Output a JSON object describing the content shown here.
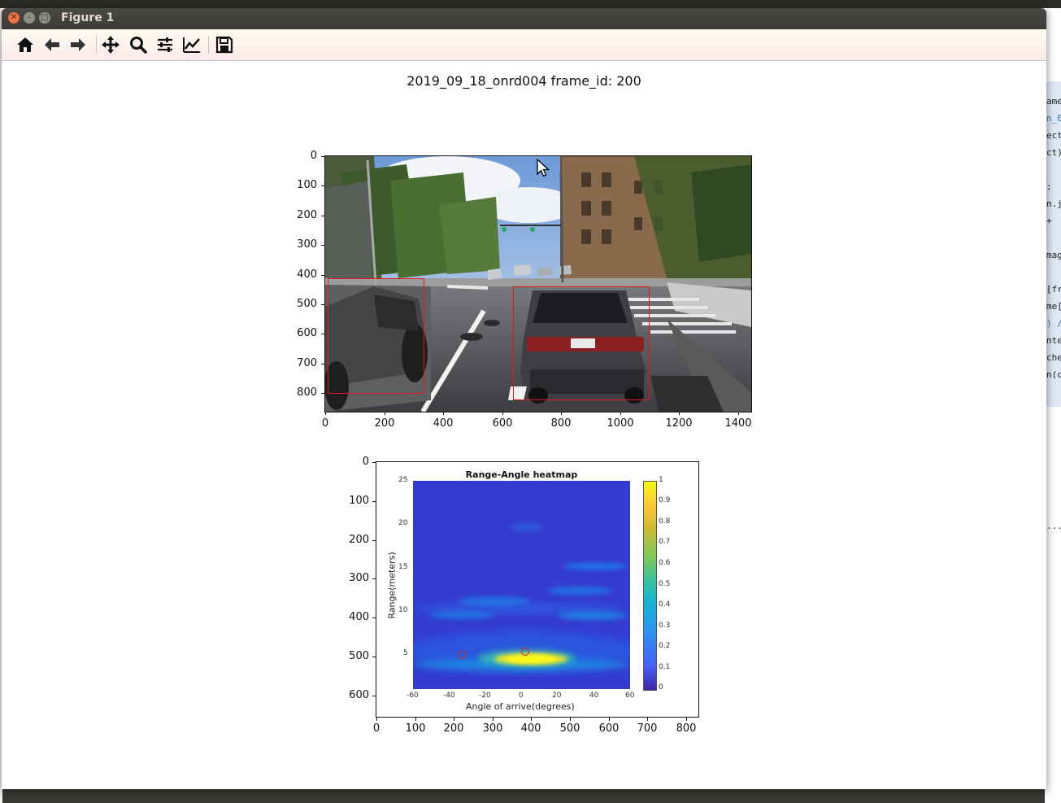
{
  "window": {
    "title": "Figure 1"
  },
  "toolbar": {
    "buttons": [
      {
        "name": "home-icon",
        "label": "Home"
      },
      {
        "name": "back-icon",
        "label": "Back"
      },
      {
        "name": "forward-icon",
        "label": "Forward"
      },
      {
        "name": "pan-icon",
        "label": "Pan"
      },
      {
        "name": "zoom-icon",
        "label": "Zoom"
      },
      {
        "name": "subplots-icon",
        "label": "Subplots"
      },
      {
        "name": "customize-icon",
        "label": "Customize"
      },
      {
        "name": "save-icon",
        "label": "Save"
      }
    ]
  },
  "figure": {
    "suptitle": "2019_09_18_onrd004 frame_id: 200",
    "image_axes": {
      "yticks": [
        "0",
        "100",
        "200",
        "300",
        "400",
        "500",
        "600",
        "700",
        "800"
      ],
      "xticks": [
        "0",
        "200",
        "400",
        "600",
        "800",
        "1000",
        "1200",
        "1400"
      ]
    },
    "heatmap_axes": {
      "yticks": [
        "0",
        "100",
        "200",
        "300",
        "400",
        "500",
        "600"
      ],
      "xticks": [
        "0",
        "100",
        "200",
        "300",
        "400",
        "500",
        "600",
        "700",
        "800"
      ]
    },
    "heatmap": {
      "title": "Range-Angle heatmap",
      "xlabel": "Angle of arrive(degrees)",
      "ylabel": "Range(meters)",
      "yticks": [
        "25",
        "20",
        "15",
        "10",
        "5"
      ],
      "xticks": [
        "-60",
        "-40",
        "-20",
        "0",
        "20",
        "40",
        "60"
      ],
      "colorbar_ticks": [
        "1",
        "0.9",
        "0.8",
        "0.7",
        "0.6",
        "0.5",
        "0.4",
        "0.3",
        "0.2",
        "0.1",
        "0"
      ]
    }
  },
  "background_editor": {
    "lines": [
      "ame",
      "n_0",
      "ect",
      "ct)",
      ":",
      "n.j",
      "+",
      "mag",
      "[fr",
      "me[",
      ") /",
      "nte",
      "che",
      "n(c",
      "..."
    ]
  },
  "colors": {
    "bbox": "#e0191e",
    "marker": "#d0202a",
    "heatmap_bg": "#343ccf",
    "titlebar": "#3c3b37"
  }
}
